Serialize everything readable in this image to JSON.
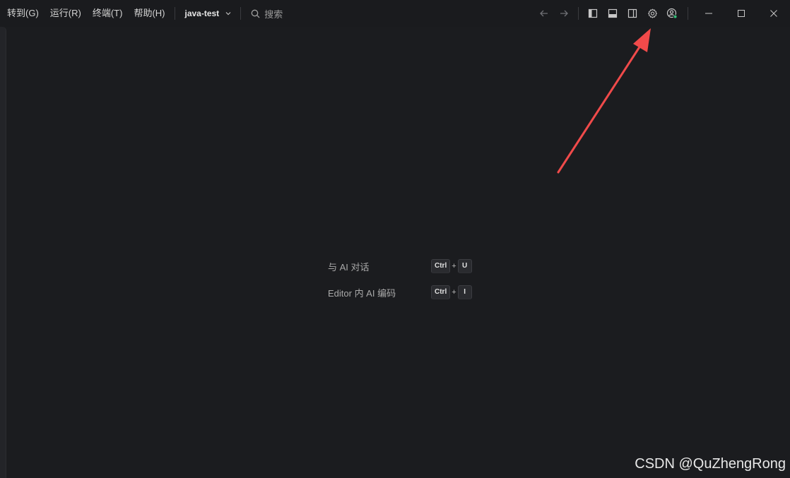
{
  "menu": {
    "items": [
      {
        "label": "转到(G)"
      },
      {
        "label": "运行(R)"
      },
      {
        "label": "终端(T)"
      },
      {
        "label": "帮助(H)"
      }
    ]
  },
  "project": {
    "name": "java-test"
  },
  "search": {
    "label": "搜索"
  },
  "shortcuts": [
    {
      "label": "与 AI 对话",
      "keys": [
        "Ctrl",
        "U"
      ],
      "plus": "+"
    },
    {
      "label": "Editor 内 AI 编码",
      "keys": [
        "Ctrl",
        "I"
      ],
      "plus": "+"
    }
  ],
  "watermark": "CSDN @QuZhengRong",
  "colors": {
    "background": "#1b1c1f",
    "titlebar": "#1a1b1e",
    "annotation_arrow": "#f04a4a",
    "account_status": "#35c07a"
  },
  "icons": {
    "back": "arrow-left-icon",
    "forward": "arrow-right-icon",
    "toggle_primary_sidebar": "layout-sidebar-left-icon",
    "toggle_panel": "layout-panel-icon",
    "toggle_secondary_sidebar": "layout-sidebar-right-icon",
    "settings": "gear-icon",
    "account": "account-icon"
  }
}
